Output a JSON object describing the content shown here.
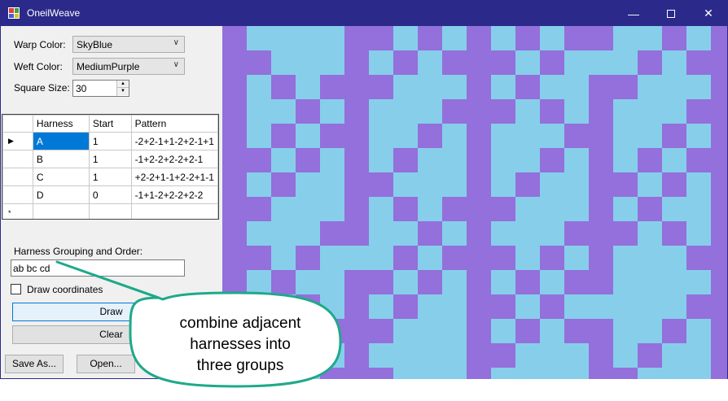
{
  "window": {
    "title": "OneilWeave",
    "minimize_icon": "minimize-icon",
    "maximize_icon": "maximize-icon",
    "close_icon": "close-icon"
  },
  "form": {
    "warp_label": "Warp Color:",
    "warp_value": "SkyBlue",
    "weft_label": "Weft Color:",
    "weft_value": "MediumPurple",
    "size_label": "Square Size:",
    "size_value": "30"
  },
  "harness_table": {
    "headers": [
      "Harness",
      "Start",
      "Pattern"
    ],
    "rows": [
      {
        "harness": "A",
        "start": "1",
        "pattern": "-2+2-1+1-2+2-1+1"
      },
      {
        "harness": "B",
        "start": "1",
        "pattern": "-1+2-2+2-2+2-1"
      },
      {
        "harness": "C",
        "start": "1",
        "pattern": "+2-2+1-1+2-2+1-1"
      },
      {
        "harness": "D",
        "start": "0",
        "pattern": "-1+1-2+2-2+2-2"
      }
    ],
    "current_row_marker": "▶",
    "new_row_marker": "*"
  },
  "grouping": {
    "label": "Harness Grouping and Order:",
    "value": "ab bc cd"
  },
  "draw_coords": {
    "label": "Draw coordinates",
    "checked": false
  },
  "buttons": {
    "draw": "Draw",
    "clear": "Clear",
    "save_as": "Save As...",
    "open": "Open..."
  },
  "callout": {
    "line1": "combine adjacent",
    "line2": "harnesses into",
    "line3": "three groups"
  },
  "colors": {
    "warp": "#87CEEB",
    "weft": "#9370DB",
    "titlebar": "#2B2A8A",
    "callout_border": "#1FA98A"
  }
}
